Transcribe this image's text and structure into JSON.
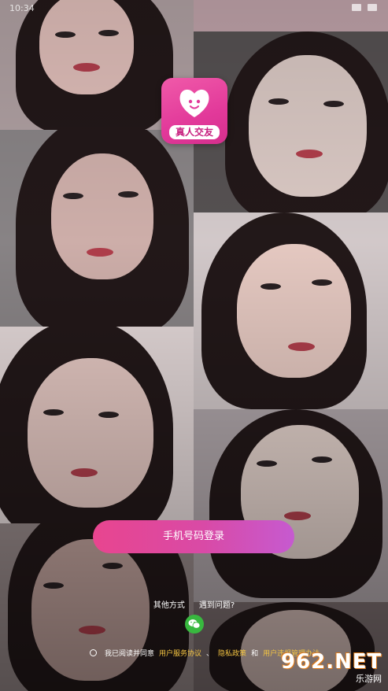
{
  "status_bar": {
    "time": "10:34"
  },
  "app": {
    "logo_text": "真人交友"
  },
  "login": {
    "phone_login_label": "手机号码登录"
  },
  "options": {
    "other_methods_label": "其他方式",
    "problem_label": "遇到问题?"
  },
  "agreement": {
    "prefix": "我已阅读并同意",
    "terms_link": "用户服务协议",
    "sep1": "、",
    "privacy_link": "隐私政策",
    "sep2": "和",
    "rules_link": "用户违规管理办法"
  },
  "watermark": {
    "brand": "962.NET",
    "subtitle": "乐游网"
  },
  "colors": {
    "accent_start": "#e8458f",
    "accent_end": "#c65ad0",
    "link": "#f5c542",
    "wechat": "#38b83f"
  }
}
